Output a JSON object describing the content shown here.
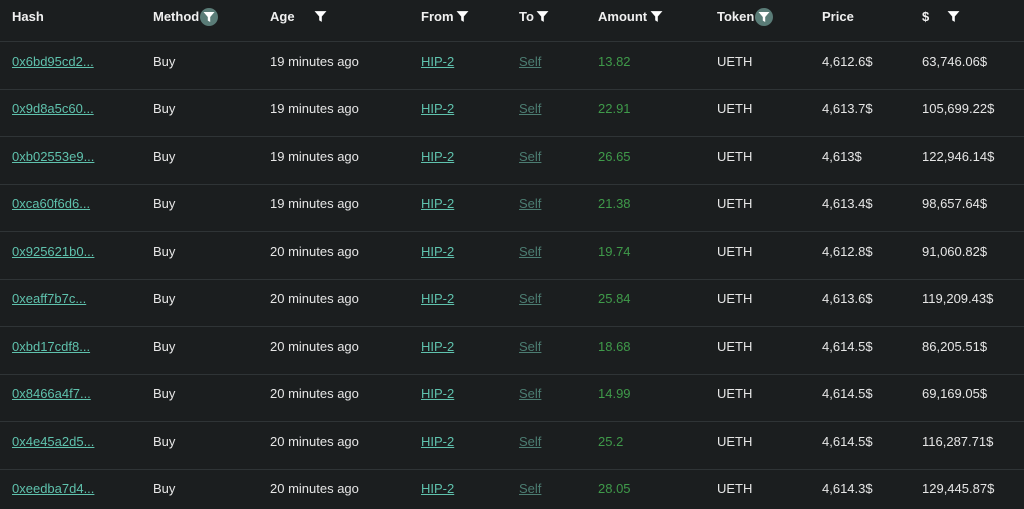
{
  "colors": {
    "background": "#1b1e1f",
    "link": "#5fc2ad",
    "link_muted": "#4c7d72",
    "amount": "#3f9a4a",
    "filter_active": "#5a7c77"
  },
  "columns": {
    "hash": "Hash",
    "method": "Method",
    "age": "Age",
    "from": "From",
    "to": "To",
    "amount": "Amount",
    "token": "Token",
    "price": "Price",
    "usd": "$"
  },
  "rows": [
    {
      "hash": "0x6bd95cd2...",
      "method": "Buy",
      "age": "19 minutes ago",
      "from": "HIP-2",
      "to": "Self",
      "amount": "13.82",
      "token": "UETH",
      "price": "4,612.6$",
      "usd": "63,746.06$"
    },
    {
      "hash": "0x9d8a5c60...",
      "method": "Buy",
      "age": "19 minutes ago",
      "from": "HIP-2",
      "to": "Self",
      "amount": "22.91",
      "token": "UETH",
      "price": "4,613.7$",
      "usd": "105,699.22$"
    },
    {
      "hash": "0xb02553e9...",
      "method": "Buy",
      "age": "19 minutes ago",
      "from": "HIP-2",
      "to": "Self",
      "amount": "26.65",
      "token": "UETH",
      "price": "4,613$",
      "usd": "122,946.14$"
    },
    {
      "hash": "0xca60f6d6...",
      "method": "Buy",
      "age": "19 minutes ago",
      "from": "HIP-2",
      "to": "Self",
      "amount": "21.38",
      "token": "UETH",
      "price": "4,613.4$",
      "usd": "98,657.64$"
    },
    {
      "hash": "0x925621b0...",
      "method": "Buy",
      "age": "20 minutes ago",
      "from": "HIP-2",
      "to": "Self",
      "amount": "19.74",
      "token": "UETH",
      "price": "4,612.8$",
      "usd": "91,060.82$"
    },
    {
      "hash": "0xeaff7b7c...",
      "method": "Buy",
      "age": "20 minutes ago",
      "from": "HIP-2",
      "to": "Self",
      "amount": "25.84",
      "token": "UETH",
      "price": "4,613.6$",
      "usd": "119,209.43$"
    },
    {
      "hash": "0xbd17cdf8...",
      "method": "Buy",
      "age": "20 minutes ago",
      "from": "HIP-2",
      "to": "Self",
      "amount": "18.68",
      "token": "UETH",
      "price": "4,614.5$",
      "usd": "86,205.51$"
    },
    {
      "hash": "0x8466a4f7...",
      "method": "Buy",
      "age": "20 minutes ago",
      "from": "HIP-2",
      "to": "Self",
      "amount": "14.99",
      "token": "UETH",
      "price": "4,614.5$",
      "usd": "69,169.05$"
    },
    {
      "hash": "0x4e45a2d5...",
      "method": "Buy",
      "age": "20 minutes ago",
      "from": "HIP-2",
      "to": "Self",
      "amount": "25.2",
      "token": "UETH",
      "price": "4,614.5$",
      "usd": "116,287.71$"
    },
    {
      "hash": "0xeedba7d4...",
      "method": "Buy",
      "age": "20 minutes ago",
      "from": "HIP-2",
      "to": "Self",
      "amount": "28.05",
      "token": "UETH",
      "price": "4,614.3$",
      "usd": "129,445.87$"
    }
  ]
}
